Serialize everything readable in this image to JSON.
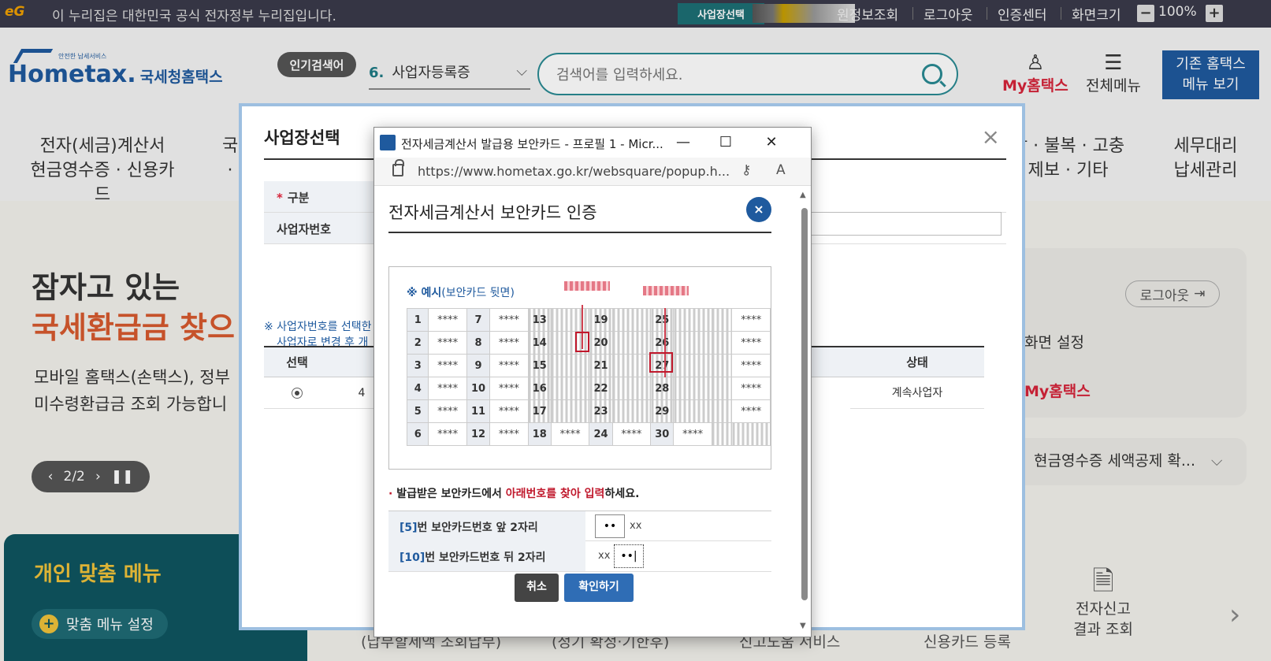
{
  "topbar": {
    "logo": "eG",
    "notice": "이 누리집은 대한민국 공식 전자정부 누리집입니다.",
    "business_tab": "사업장선택",
    "links": [
      "원정보조회",
      "로그아웃",
      "인증센터",
      "화면크기"
    ],
    "zoom_minus": "−",
    "zoom_value": "100%",
    "zoom_plus": "+"
  },
  "header": {
    "logo_sub": "안전한 납세서비스",
    "logo_main": "Hometax.",
    "logo_kr": "국세청홈택스",
    "popular_badge": "인기검색어",
    "popular_rank": "6.",
    "popular_keyword": "사업자등록증",
    "search_placeholder": "검색어를 입력하세요.",
    "my_hometax": "My홈택스",
    "all_menu": "전체메뉴",
    "old_menu_line1": "기존 홈택스",
    "old_menu_line2": "메뉴 보기"
  },
  "gnb": [
    {
      "line1": "전자(세금)계산서",
      "line2": "현금영수증 · 신용카드"
    },
    {
      "line1": "국",
      "line2": "·"
    },
    {
      "line1": "감 · 불복 · 고충",
      "line2": "제보 · 기타"
    },
    {
      "line1": "세무대리",
      "line2": "납세관리"
    }
  ],
  "hero": {
    "line1": "잠자고 있는",
    "line2": "국세환급금 찾으",
    "desc1": "모바일 홈택스(손택스), 정부",
    "desc2": "미수령환급금 조회 가능합니",
    "pager": "2/2"
  },
  "personal_menu": {
    "title": "개인 맞춤 메뉴",
    "setting": "맞춤 메뉴 설정"
  },
  "right_card": {
    "logout": "로그아웃",
    "screen_setting": "화면 설정",
    "my_hometax": "My홈택스",
    "cash_receipt": "현금영수증 세액공제 확..."
  },
  "bottom": {
    "items": [
      "(납부할세액 조회납부)",
      "(정기 확정·기한후)",
      "신고도움 서비스",
      "신용카드 등록"
    ],
    "quick_line1": "전자신고",
    "quick_line2": "결과 조회"
  },
  "outer_modal": {
    "title": "사업장선택",
    "close": "×",
    "row1_label": "구분",
    "row2_label": "사업자번호",
    "note1": "※ 사업자번호를 선택한",
    "note2": "사업자로 변경 후 개",
    "col_select": "선택",
    "col_status": "상태",
    "row_partial": "4",
    "row_status": "계속사업자"
  },
  "popup": {
    "window_title": "전자세금계산서 발급용 보안카드 - 프로필 1 - Micr...",
    "url": "https://www.hometax.go.kr/websquare/popup.h...",
    "heading": "전자세금계산서 보안카드 인증",
    "close": "×",
    "example_title": "※ 예시",
    "example_sub": "(보안카드 뒷면)",
    "grid": [
      [
        [
          "1",
          "****"
        ],
        [
          "7",
          "****"
        ],
        [
          "13",
          ""
        ],
        [
          "19",
          ""
        ],
        [
          "25",
          ""
        ],
        [
          "",
          "****"
        ]
      ],
      [
        [
          "2",
          "****"
        ],
        [
          "8",
          "****"
        ],
        [
          "14",
          ""
        ],
        [
          "20",
          ""
        ],
        [
          "26",
          ""
        ],
        [
          "",
          "****"
        ]
      ],
      [
        [
          "3",
          "****"
        ],
        [
          "9",
          "****"
        ],
        [
          "15",
          ""
        ],
        [
          "21",
          ""
        ],
        [
          "27",
          ""
        ],
        [
          "",
          "****"
        ]
      ],
      [
        [
          "4",
          "****"
        ],
        [
          "10",
          "****"
        ],
        [
          "16",
          ""
        ],
        [
          "22",
          ""
        ],
        [
          "28",
          ""
        ],
        [
          "",
          "****"
        ]
      ],
      [
        [
          "5",
          "****"
        ],
        [
          "11",
          "****"
        ],
        [
          "17",
          ""
        ],
        [
          "23",
          ""
        ],
        [
          "29",
          ""
        ],
        [
          "",
          "****"
        ]
      ],
      [
        [
          "6",
          "****"
        ],
        [
          "12",
          "****"
        ],
        [
          "18",
          "****"
        ],
        [
          "24",
          "****"
        ],
        [
          "30",
          "****"
        ],
        [
          "",
          ""
        ]
      ]
    ],
    "instruction_prefix": "발급받은 보안카드에서 ",
    "instruction_red": "아래번호를 찾아 입력",
    "instruction_suffix": "하세요.",
    "row1_num": "[5]",
    "row1_text": "번 보안카드번호 앞 2자리",
    "row1_value": "••",
    "row1_mask": "xx",
    "row2_num": "[10]",
    "row2_text": "번 보안카드번호 뒤 2자리",
    "row2_mask": "xx",
    "row2_value": "••|",
    "cancel": "취소",
    "confirm": "확인하기"
  }
}
